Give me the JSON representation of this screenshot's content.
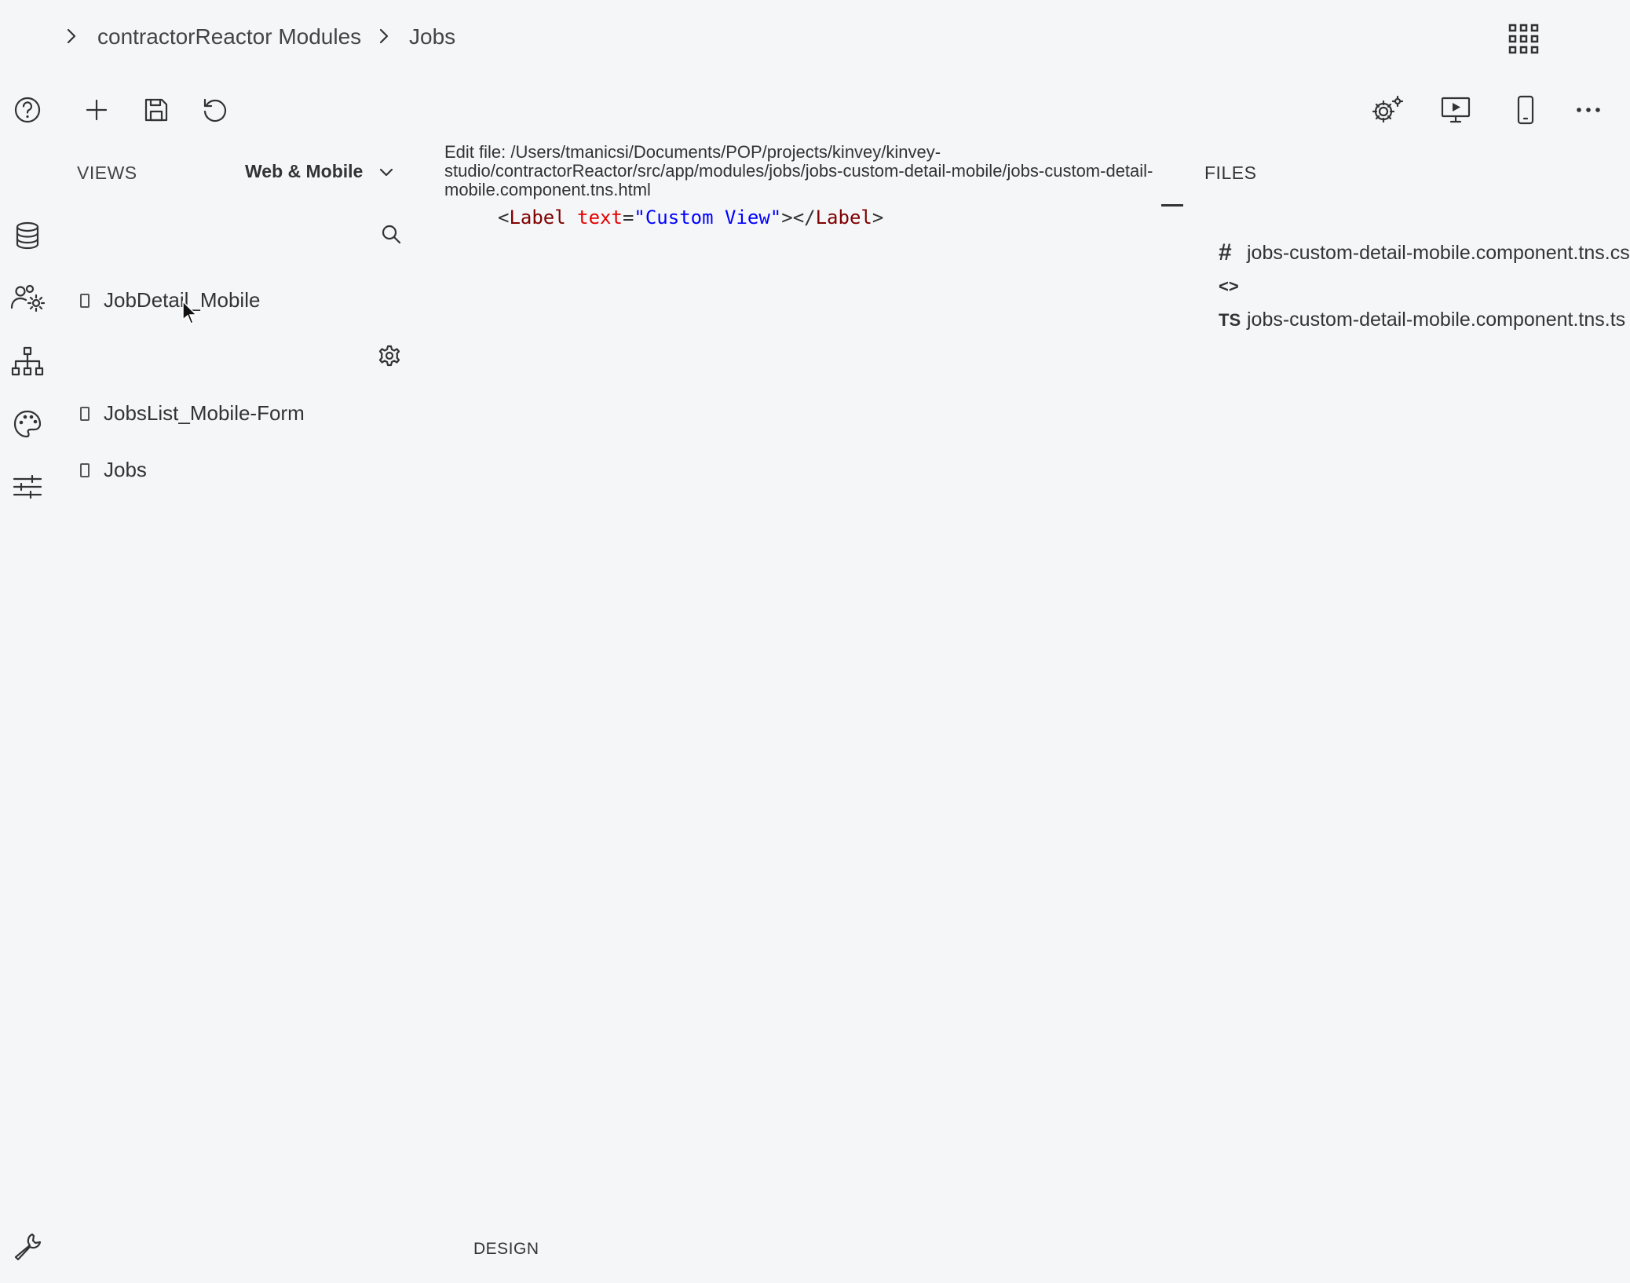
{
  "breadcrumb": {
    "items": [
      "contractorReactor Modules",
      "Jobs"
    ]
  },
  "toolbar": {
    "left_icons": [
      "help-icon",
      "add-icon",
      "save-icon",
      "undo-icon"
    ],
    "right_icons": [
      "settings-gear-icon",
      "preview-desktop-icon",
      "mobile-device-icon",
      "more-options-icon"
    ]
  },
  "sidebar_icons": [
    "database-icon",
    "users-settings-icon",
    "hierarchy-icon",
    "palette-icon",
    "sliders-icon",
    "wrench-icon"
  ],
  "views": {
    "header": "VIEWS",
    "platform": "Web & Mobile",
    "items": [
      "JobDetail_Mobile",
      "JobsList_Mobile-Form",
      "Jobs"
    ]
  },
  "editor": {
    "path": "Edit file: /Users/tmanicsi/Documents/POP/projects/kinvey/kinvey-studio/contractorReactor/src/app/modules/jobs/jobs-custom-detail-mobile/jobs-custom-detail-mobile.component.tns.html",
    "code": {
      "open": "<",
      "tag": "Label",
      "attr": "text",
      "eq": "=",
      "value": "\"Custom View\"",
      "close": "></",
      "tag_end": "Label",
      "end": ">"
    }
  },
  "files": {
    "header": "FILES",
    "items": [
      {
        "icon": "#",
        "name": "jobs-custom-detail-mobile.component.tns.css"
      },
      {
        "icon": "<>",
        "name": ""
      },
      {
        "icon": "TS",
        "name": "jobs-custom-detail-mobile.component.tns.ts"
      }
    ]
  },
  "bottom": {
    "design_tab": "DESIGN"
  },
  "colors": {
    "background": "#f5f6f8",
    "code_tag": "#800000",
    "code_attr": "#e50000",
    "code_string": "#0000ff"
  }
}
